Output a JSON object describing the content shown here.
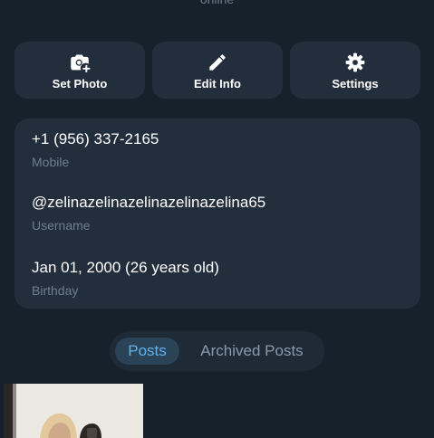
{
  "header": {
    "status_text": "online"
  },
  "actions": [
    {
      "label": "Set Photo",
      "icon": "camera-add-icon"
    },
    {
      "label": "Edit Info",
      "icon": "pencil-icon"
    },
    {
      "label": "Settings",
      "icon": "gear-icon"
    }
  ],
  "info": {
    "phone": {
      "value": "+1 (956) 337-2165",
      "label": "Mobile"
    },
    "username": {
      "value": "@zelinazelinazelinazelinazelina65",
      "label": "Username"
    },
    "birthday": {
      "value": "Jan 01, 2000 (26 years old)",
      "label": "Birthday"
    }
  },
  "tabs": [
    {
      "label": "Posts",
      "active": true
    },
    {
      "label": "Archived Posts",
      "active": false
    }
  ],
  "colors": {
    "background": "#17212b",
    "card": "#232e3c",
    "accent": "#5fb3f0",
    "secondary_text": "#6d7f8f"
  }
}
